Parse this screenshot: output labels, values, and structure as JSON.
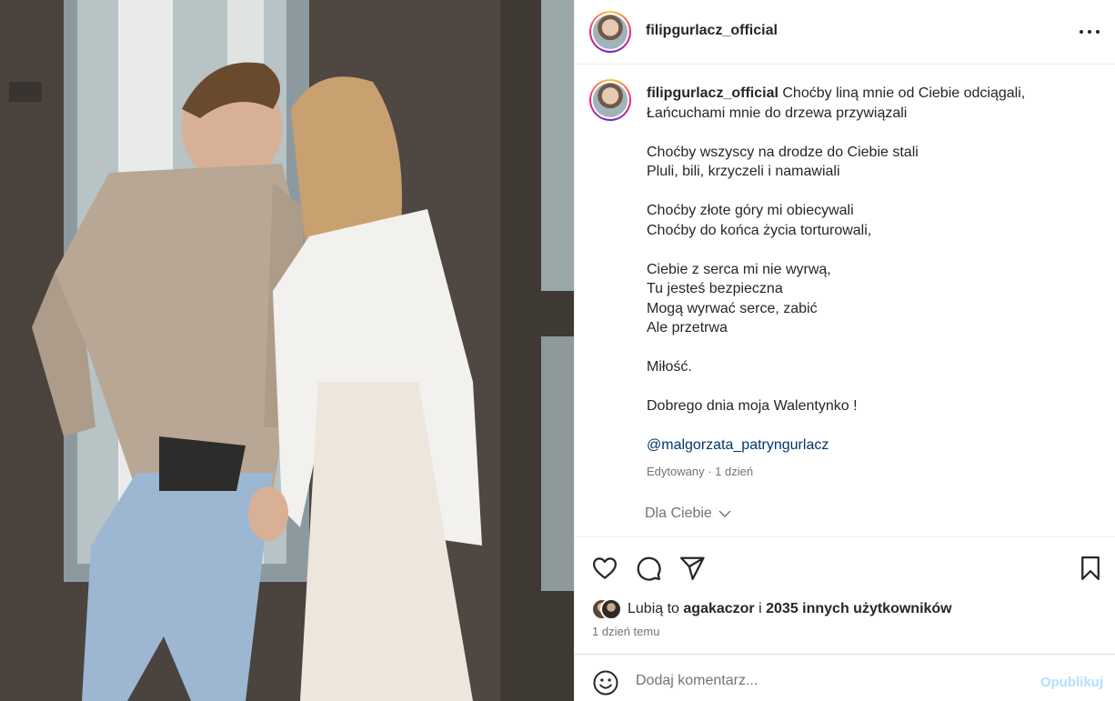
{
  "post": {
    "username": "filipgurlacz_official",
    "caption_lines": [
      "Choćby liną mnie od Ciebie odciągali,",
      "Łańcuchami mnie do drzewa przywiązali",
      "",
      "Choćby wszyscy na drodze do Ciebie stali",
      "Pluli, bili, krzyczeli i namawiali",
      "",
      "Choćby złote góry mi obiecywali",
      "Choćby do końca życia torturowali,",
      "",
      "Ciebie z serca mi nie wyrwą,",
      "Tu jesteś bezpieczna",
      "Mogą wyrwać serce, zabić",
      "Ale przetrwa",
      "",
      "Miłość.",
      "",
      "Dobrego dnia moja Walentynko !",
      ""
    ],
    "mention": "@malgorzata_patryngurlacz",
    "edited_label": "Edytowany · 1 dzień",
    "for_you_label": "Dla Ciebie",
    "likes": {
      "prefix": "Lubią to",
      "user": "agakaczor",
      "connector": "i",
      "others": "2035 innych użytkowników"
    },
    "time_ago": "1 dzień temu"
  },
  "comment": {
    "placeholder": "Dodaj komentarz...",
    "publish_label": "Opublikuj"
  },
  "colors": {
    "link": "#00376b",
    "publish_disabled": "#b2dffc",
    "muted": "#737373"
  },
  "icons": [
    "more-icon",
    "heart-icon",
    "comment-icon",
    "share-icon",
    "bookmark-icon",
    "chevron-down-icon",
    "emoji-icon"
  ]
}
